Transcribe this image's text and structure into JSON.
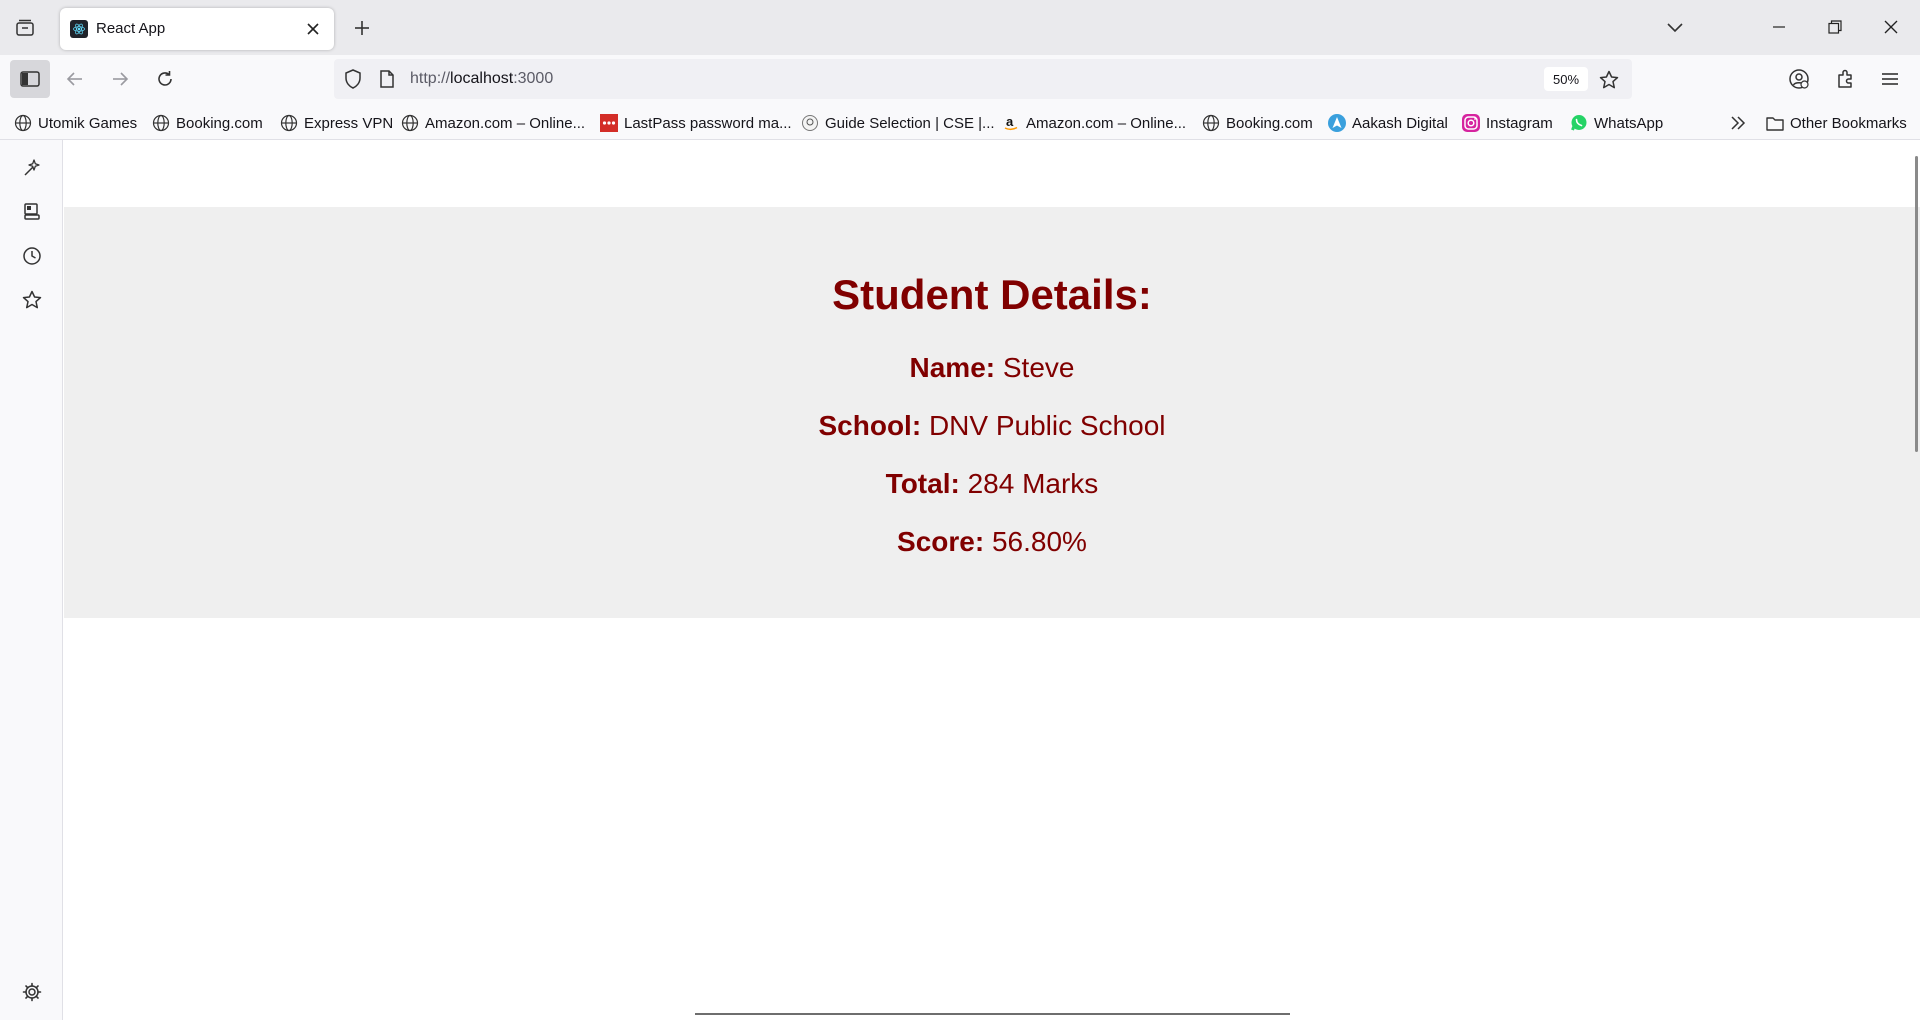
{
  "tab": {
    "title": "React App",
    "close_label": "Close tab",
    "new_tab_label": "New tab"
  },
  "url": {
    "scheme": "http://",
    "host": "localhost",
    "port": ":3000",
    "zoom": "50%"
  },
  "bookmarks": [
    {
      "label": "Utomik Games",
      "icon": "globe-icon"
    },
    {
      "label": "Booking.com",
      "icon": "globe-icon"
    },
    {
      "label": "Express VPN",
      "icon": "globe-icon"
    },
    {
      "label": "Amazon.com – Online...",
      "icon": "globe-icon"
    },
    {
      "label": "LastPass password ma...",
      "icon": "lastpass-icon"
    },
    {
      "label": "Guide Selection | CSE |...",
      "icon": "guide-icon"
    },
    {
      "label": "Amazon.com – Online...",
      "icon": "amazon-icon"
    },
    {
      "label": "Booking.com",
      "icon": "globe-icon"
    },
    {
      "label": "Aakash Digital",
      "icon": "aakash-icon"
    },
    {
      "label": "Instagram",
      "icon": "instagram-icon"
    },
    {
      "label": "WhatsApp",
      "icon": "whatsapp-icon"
    }
  ],
  "other_bookmarks": "Other Bookmarks",
  "page": {
    "heading": "Student Details:",
    "name_label": "Name:",
    "name_value": "Steve",
    "school_label": "School:",
    "school_value": "DNV Public School",
    "total_label": "Total:",
    "total_value": "284 Marks",
    "score_label": "Score:",
    "score_value": "56.80%"
  },
  "colors": {
    "accent": "#800000",
    "panel_bg": "#efefef",
    "chrome_bg": "#eaeaed",
    "toolbar_bg": "#f9f9fb"
  }
}
